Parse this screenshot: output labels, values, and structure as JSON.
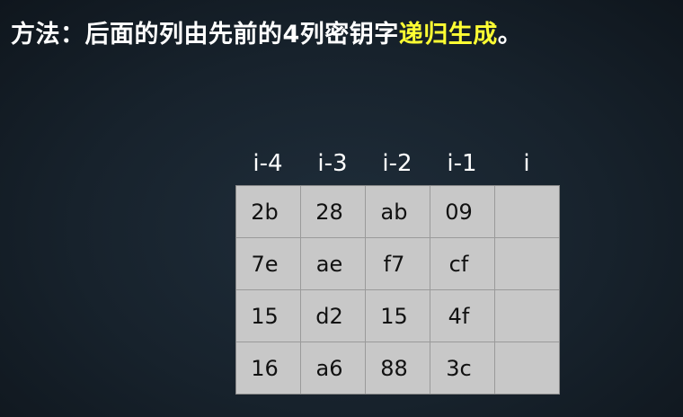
{
  "title": {
    "prefix": "方法：后面的列由先前的4列密钥字",
    "highlight": "递归生成",
    "suffix": "。"
  },
  "table": {
    "headers": [
      "i-4",
      "i-3",
      "i-2",
      "i-1",
      "i"
    ],
    "rows": [
      [
        "2b",
        "28",
        "ab",
        "09",
        ""
      ],
      [
        "7e",
        "ae",
        "f7",
        "cf",
        ""
      ],
      [
        "15",
        "d2",
        "15",
        "4f",
        ""
      ],
      [
        "16",
        "a6",
        "88",
        "3c",
        ""
      ]
    ]
  }
}
